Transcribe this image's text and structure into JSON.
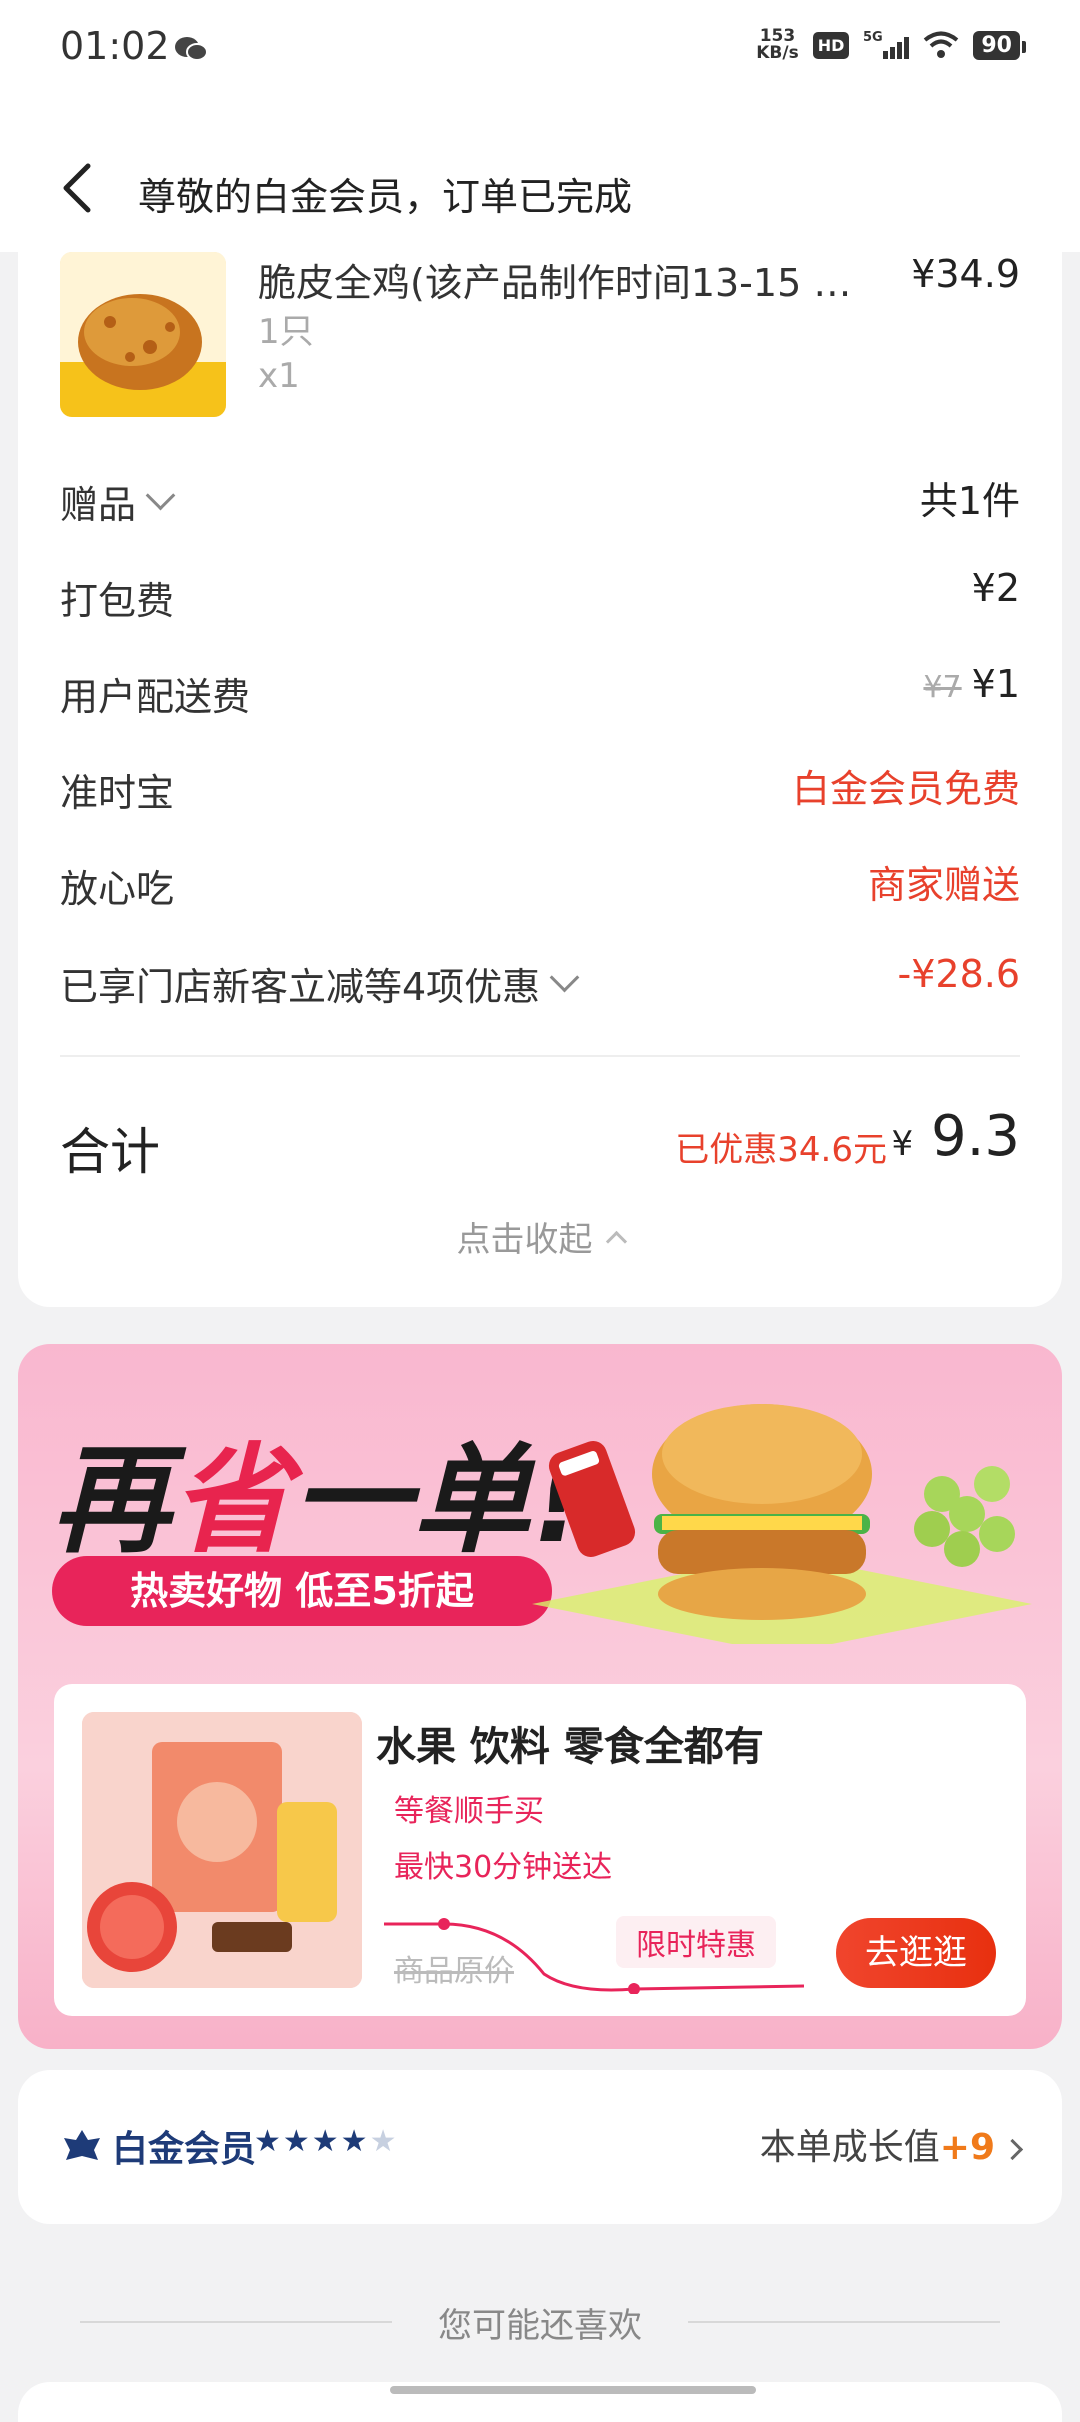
{
  "status_bar": {
    "time": "01:02",
    "net_speed": "153",
    "net_unit": "KB/s",
    "hd": "HD",
    "signal": "5G",
    "battery": "90"
  },
  "header": {
    "title": "尊敬的白金会员，订单已完成"
  },
  "item": {
    "name": "脆皮全鸡(该产品制作时间13-15 …",
    "price": "¥34.9",
    "spec": "1只",
    "qty": "x1"
  },
  "fees": [
    {
      "label": "赠品",
      "value": "共1件"
    },
    {
      "label": "打包费",
      "value": "¥2"
    },
    {
      "label": "用户配送费",
      "orig": "¥7",
      "value": "¥1"
    },
    {
      "label": "准时宝",
      "value": "白金会员免费"
    },
    {
      "label": "放心吃",
      "value": "商家赠送"
    },
    {
      "label": "已享门店新客立减等4项优惠",
      "value": "-¥28.6"
    }
  ],
  "total": {
    "label": "合计",
    "saved": "已优惠34.6元",
    "currency": "¥",
    "amount": "9.3"
  },
  "collapse_label": "点击收起",
  "banner": {
    "headline_a": "再",
    "headline_b": "省",
    "headline_c": "一单!",
    "pill": "热卖好物 低至5折起",
    "card_title": "水果 饮料 零食全都有",
    "card_sub1": "等餐顺手买",
    "card_sub2": "最快30分钟送达",
    "orig_label": "商品原价",
    "limited_label": "限时特惠",
    "button": "去逛逛"
  },
  "member": {
    "name": "白金会员",
    "stars_filled": "★★★★",
    "stars_empty": "★",
    "growth_label": "本单成长值",
    "growth_value": "+9"
  },
  "recommend_label": "您可能还喜欢"
}
